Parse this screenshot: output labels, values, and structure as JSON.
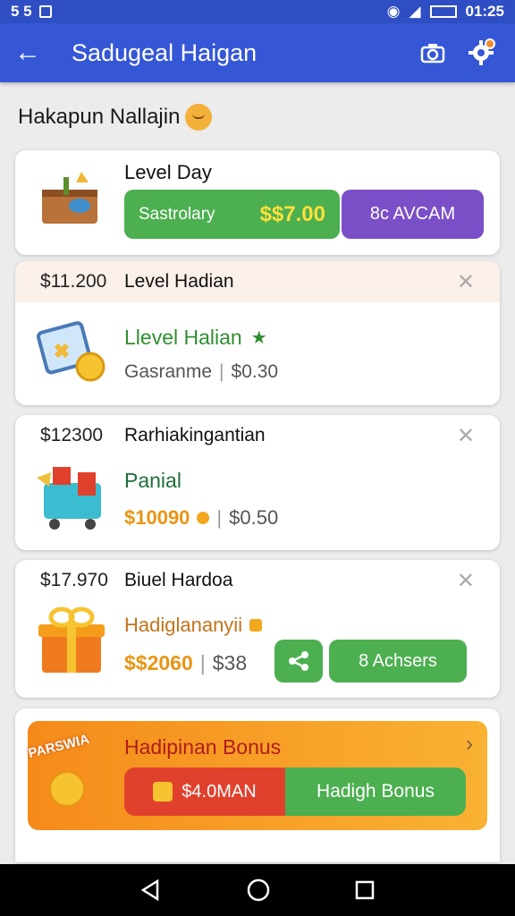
{
  "status": {
    "left": "5 5",
    "time": "01:25"
  },
  "appbar": {
    "title": "Sadugeal Haigan"
  },
  "greeting": {
    "text": "Hakapun Nallajin"
  },
  "card1": {
    "title": "Level Day",
    "green_label": "Sastrolary",
    "green_amount": "$$7.00",
    "purple_label": "8c AVCAM"
  },
  "card2": {
    "amount": "$11.200",
    "name": "Level Hadian",
    "subtitle": "Llevel Halian",
    "meta_label": "Gasranme",
    "meta_value": "$0.30"
  },
  "card3": {
    "amount": "$12300",
    "name": "Rarhiakingantian",
    "subtitle": "Panial",
    "price": "$10090",
    "meta_value": "$0.50"
  },
  "card4": {
    "amount": "$17.970",
    "name": "Biuel Hardoa",
    "subtitle": "Hadiglananyii",
    "price": "$$2060",
    "meta_value": "$38",
    "button_label": "8 Achsers"
  },
  "bonus": {
    "badge": "PARSWIA",
    "title": "Hadipinan Bonus",
    "left_label": "$4.0MAN",
    "right_label": "Hadigh Bonus"
  },
  "colors": {
    "primary": "#3557d6",
    "green": "#4caf50",
    "purple": "#7b4fc8",
    "orange": "#f59d1a",
    "red": "#e0412c",
    "gold": "#e89514"
  }
}
